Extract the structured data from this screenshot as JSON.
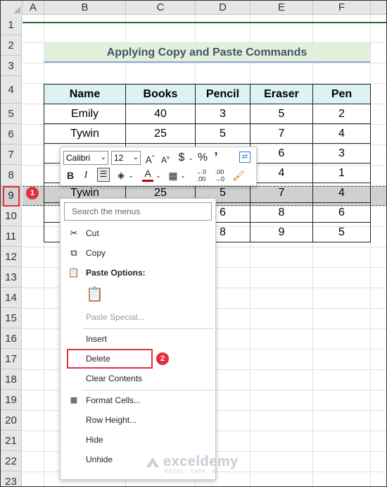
{
  "columns": [
    "A",
    "B",
    "C",
    "D",
    "E",
    "F"
  ],
  "rows": [
    "1",
    "2",
    "3",
    "4",
    "5",
    "6",
    "7",
    "8",
    "9",
    "10",
    "11",
    "12",
    "13",
    "14",
    "15",
    "16",
    "17",
    "18",
    "19",
    "20",
    "21",
    "22",
    "23"
  ],
  "title": "Applying Copy and Paste Commands",
  "table": {
    "headers": [
      "Name",
      "Books",
      "Pencil",
      "Eraser",
      "Pen"
    ],
    "rows": [
      [
        "Emily",
        "40",
        "3",
        "5",
        "2"
      ],
      [
        "Tywin",
        "25",
        "5",
        "7",
        "4"
      ],
      [
        "",
        "",
        "",
        "6",
        "3"
      ],
      [
        "",
        "",
        "",
        "4",
        "1"
      ],
      [
        "Tywin",
        "25",
        "5",
        "7",
        "4"
      ],
      [
        "",
        "",
        "6",
        "8",
        "6"
      ],
      [
        "",
        "",
        "8",
        "9",
        "5"
      ]
    ]
  },
  "mini_toolbar": {
    "font": "Calibri",
    "size": "12"
  },
  "context_menu": {
    "search_placeholder": "Search the menus",
    "cut": "Cut",
    "copy": "Copy",
    "paste_options": "Paste Options:",
    "paste_special": "Paste Special...",
    "insert": "Insert",
    "delete": "Delete",
    "clear_contents": "Clear Contents",
    "format_cells": "Format Cells...",
    "row_height": "Row Height...",
    "hide": "Hide",
    "unhide": "Unhide"
  },
  "badges": {
    "one": "1",
    "two": "2"
  },
  "watermark": {
    "brand": "exceldemy",
    "tagline": "EXCEL · DATA · BI"
  },
  "colors": {
    "accent_red": "#e0323a",
    "title_fill": "#e2efda",
    "header_fill": "#ddf3f3"
  }
}
